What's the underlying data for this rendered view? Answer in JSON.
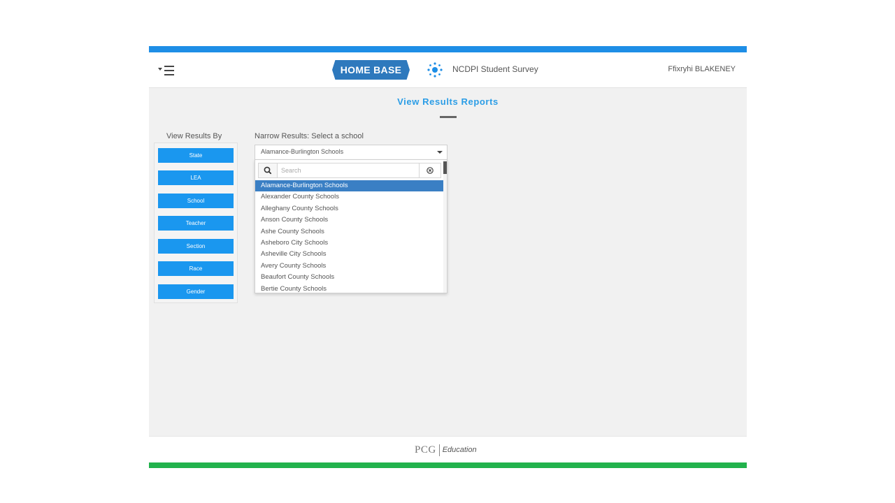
{
  "colors": {
    "top_strip": "#1e8ee6",
    "bottom_strip": "#22b24c",
    "button_blue": "#1a97ef",
    "heading_blue": "#2b9de6",
    "selected_option": "#3a7fc4",
    "logo_blue": "#2e79bd"
  },
  "header": {
    "menu_icon": "hamburger-menu-icon",
    "logo_text": "HOME BASE",
    "survey_icon": "dots-spinner-icon",
    "survey_title": "NCDPI Student Survey",
    "user_name": "Ffixryhi BLAKENEY"
  },
  "page": {
    "title": "View Results Reports"
  },
  "view_by": {
    "label": "View Results By",
    "buttons": [
      "State",
      "LEA",
      "School",
      "Teacher",
      "Section",
      "Race",
      "Gender"
    ]
  },
  "narrow": {
    "label": "Narrow Results: Select a school",
    "selected": "Alamance-Burlington Schools",
    "search_placeholder": "Search",
    "search_icon": "search-icon",
    "clear_icon": "clear-circle-icon",
    "options": [
      "Alamance-Burlington Schools",
      "Alexander County Schools",
      "Alleghany County Schools",
      "Anson County Schools",
      "Ashe County Schools",
      "Asheboro City Schools",
      "Asheville City Schools",
      "Avery County Schools",
      "Beaufort County Schools",
      "Bertie County Schools"
    ]
  },
  "footer": {
    "brand": "PCG",
    "brand_sub": "Education"
  }
}
